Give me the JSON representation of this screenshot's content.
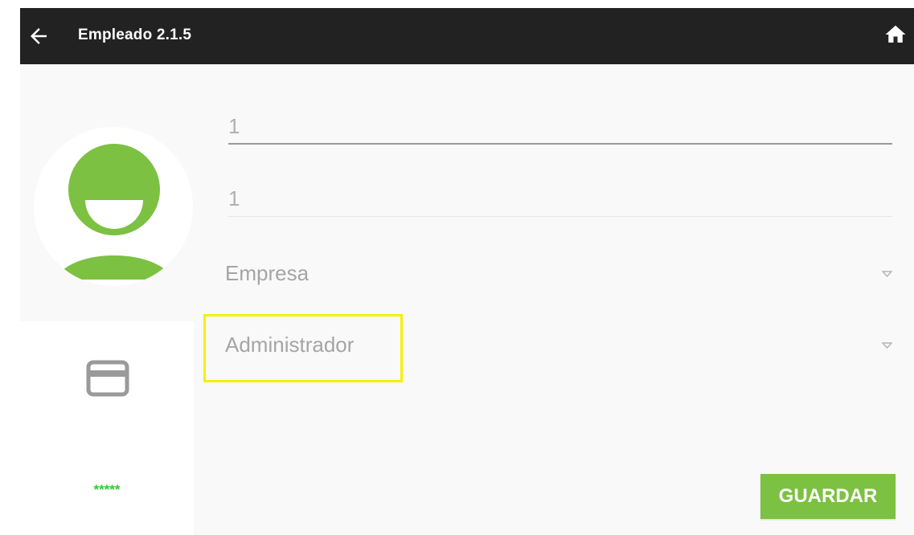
{
  "appbar": {
    "title": "Empleado 2.1.5",
    "back_icon": "arrow-left-icon",
    "home_icon": "home-icon",
    "background": "#222222"
  },
  "form": {
    "field1_value": "1",
    "field2_value": "1",
    "company_spinner_label": "Empresa",
    "role_spinner_label": "Administrador"
  },
  "left_panel": {
    "avatar_icon": "user-avatar-icon",
    "card_icon": "credit-card-icon",
    "password_mask": "*****"
  },
  "actions": {
    "save_label": "GUARDAR"
  },
  "colors": {
    "accent_green": "#7cc142",
    "highlight_yellow": "#f5f000",
    "password_green": "#2ecc2e"
  }
}
